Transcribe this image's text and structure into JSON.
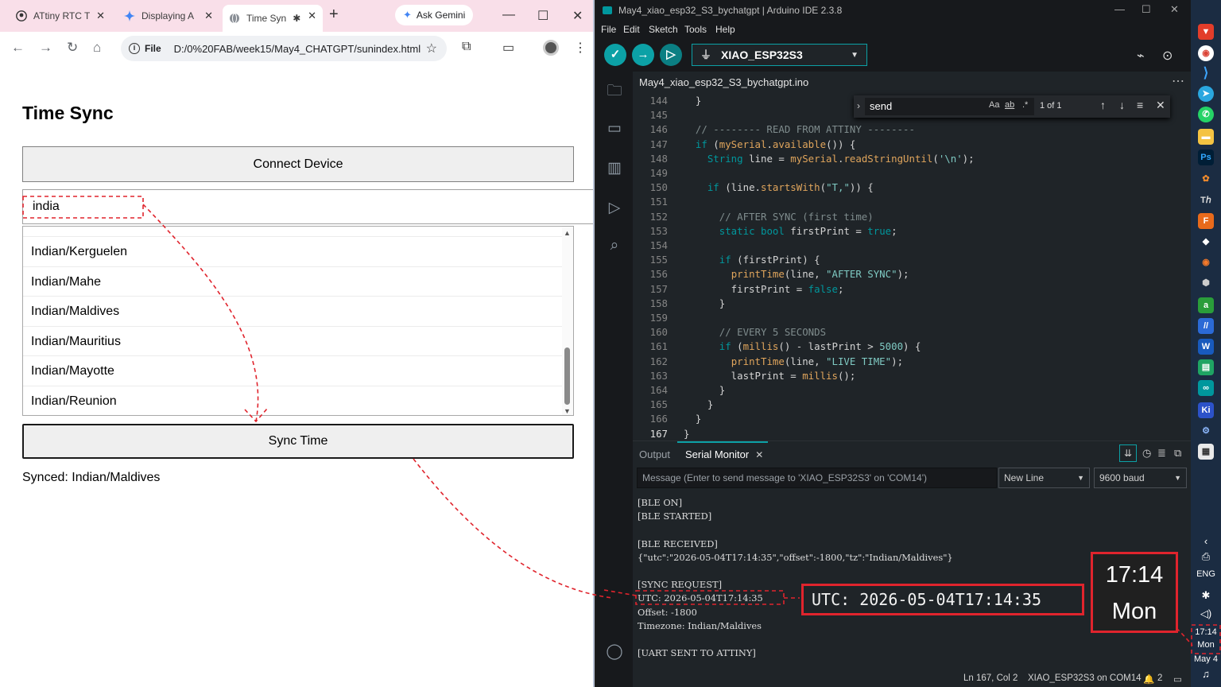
{
  "browser": {
    "tabs": [
      {
        "title": "ATtiny RTC T",
        "icon": "github-icon"
      },
      {
        "title": "Displaying A",
        "icon": "gemini-icon"
      },
      {
        "title": "Time Syn",
        "icon": "globe-icon",
        "active": true
      }
    ],
    "ask_gemini": "Ask Gemini",
    "window_controls": {
      "minimize": "—",
      "maximize": "☐",
      "close": "✕"
    },
    "address": {
      "scheme_chip": "File",
      "url": "D:/0%20FAB/week15/May4_CHATGPT/sunindex.html"
    }
  },
  "page": {
    "title": "Time Sync",
    "connect_button": "Connect Device",
    "search_value": "india",
    "timezones": [
      "Indian/Kerguelen",
      "Indian/Mahe",
      "Indian/Maldives",
      "Indian/Mauritius",
      "Indian/Mayotte",
      "Indian/Reunion"
    ],
    "sync_button": "Sync Time",
    "status": "Synced: Indian/Maldives"
  },
  "ide": {
    "title": "May4_xiao_esp32_S3_bychatgpt | Arduino IDE 2.3.8",
    "menu": [
      "File",
      "Edit",
      "Sketch",
      "Tools",
      "Help"
    ],
    "board": "XIAO_ESP32S3",
    "file_tab": "May4_xiao_esp32_S3_bychatgpt.ino",
    "find": {
      "query": "send",
      "case_opt": "Aa",
      "word_opt": "ab",
      "regex_opt": ".*",
      "count": "1 of 1"
    },
    "code": [
      {
        "ln": "144",
        "src": "  }"
      },
      {
        "ln": "145",
        "src": ""
      },
      {
        "ln": "146",
        "src": "  // -------- READ FROM ATTINY --------"
      },
      {
        "ln": "147",
        "src": "  if (mySerial.available()) {"
      },
      {
        "ln": "148",
        "src": "    String line = mySerial.readStringUntil('\\n');"
      },
      {
        "ln": "149",
        "src": ""
      },
      {
        "ln": "150",
        "src": "    if (line.startsWith(\"T,\")) {"
      },
      {
        "ln": "151",
        "src": ""
      },
      {
        "ln": "152",
        "src": "      // AFTER SYNC (first time)"
      },
      {
        "ln": "153",
        "src": "      static bool firstPrint = true;"
      },
      {
        "ln": "154",
        "src": ""
      },
      {
        "ln": "155",
        "src": "      if (firstPrint) {"
      },
      {
        "ln": "156",
        "src": "        printTime(line, \"AFTER SYNC\");"
      },
      {
        "ln": "157",
        "src": "        firstPrint = false;"
      },
      {
        "ln": "158",
        "src": "      }"
      },
      {
        "ln": "159",
        "src": ""
      },
      {
        "ln": "160",
        "src": "      // EVERY 5 SECONDS"
      },
      {
        "ln": "161",
        "src": "      if (millis() - lastPrint > 5000) {"
      },
      {
        "ln": "162",
        "src": "        printTime(line, \"LIVE TIME\");"
      },
      {
        "ln": "163",
        "src": "        lastPrint = millis();"
      },
      {
        "ln": "164",
        "src": "      }"
      },
      {
        "ln": "165",
        "src": "    }"
      },
      {
        "ln": "166",
        "src": "  }"
      },
      {
        "ln": "167",
        "src": "}"
      }
    ],
    "panel": {
      "output_tab": "Output",
      "monitor_tab": "Serial Monitor",
      "message_placeholder": "Message (Enter to send message to 'XIAO_ESP32S3' on 'COM14')",
      "line_ending": "New Line",
      "baud": "9600 baud",
      "serial_lines": [
        "[BLE ON]",
        "[BLE STARTED]",
        "",
        "[BLE RECEIVED]",
        "{\"utc\":\"2026-05-04T17:14:35\",\"offset\":-1800,\"tz\":\"Indian/Maldives\"}",
        "",
        "[SYNC REQUEST]",
        "UTC: 2026-05-04T17:14:35",
        "Offset: -1800",
        "Timezone: Indian/Maldives",
        "",
        "[UART SENT TO ATTINY]"
      ]
    },
    "statusbar": {
      "position": "Ln 167, Col 2",
      "board_port": "XIAO_ESP32S3 on COM14",
      "notifications": "2"
    }
  },
  "callouts": {
    "utc": "UTC: 2026-05-04T17:14:35",
    "clock_time": "17:14",
    "clock_day": "Mon"
  },
  "taskbar": {
    "language": "ENG",
    "time": "17:14",
    "day": "Mon",
    "date": "May 4"
  },
  "colors": {
    "annotation": "#e0242d",
    "arduino_teal": "#0ca1a6",
    "tabstrip": "#f9dfe9"
  }
}
